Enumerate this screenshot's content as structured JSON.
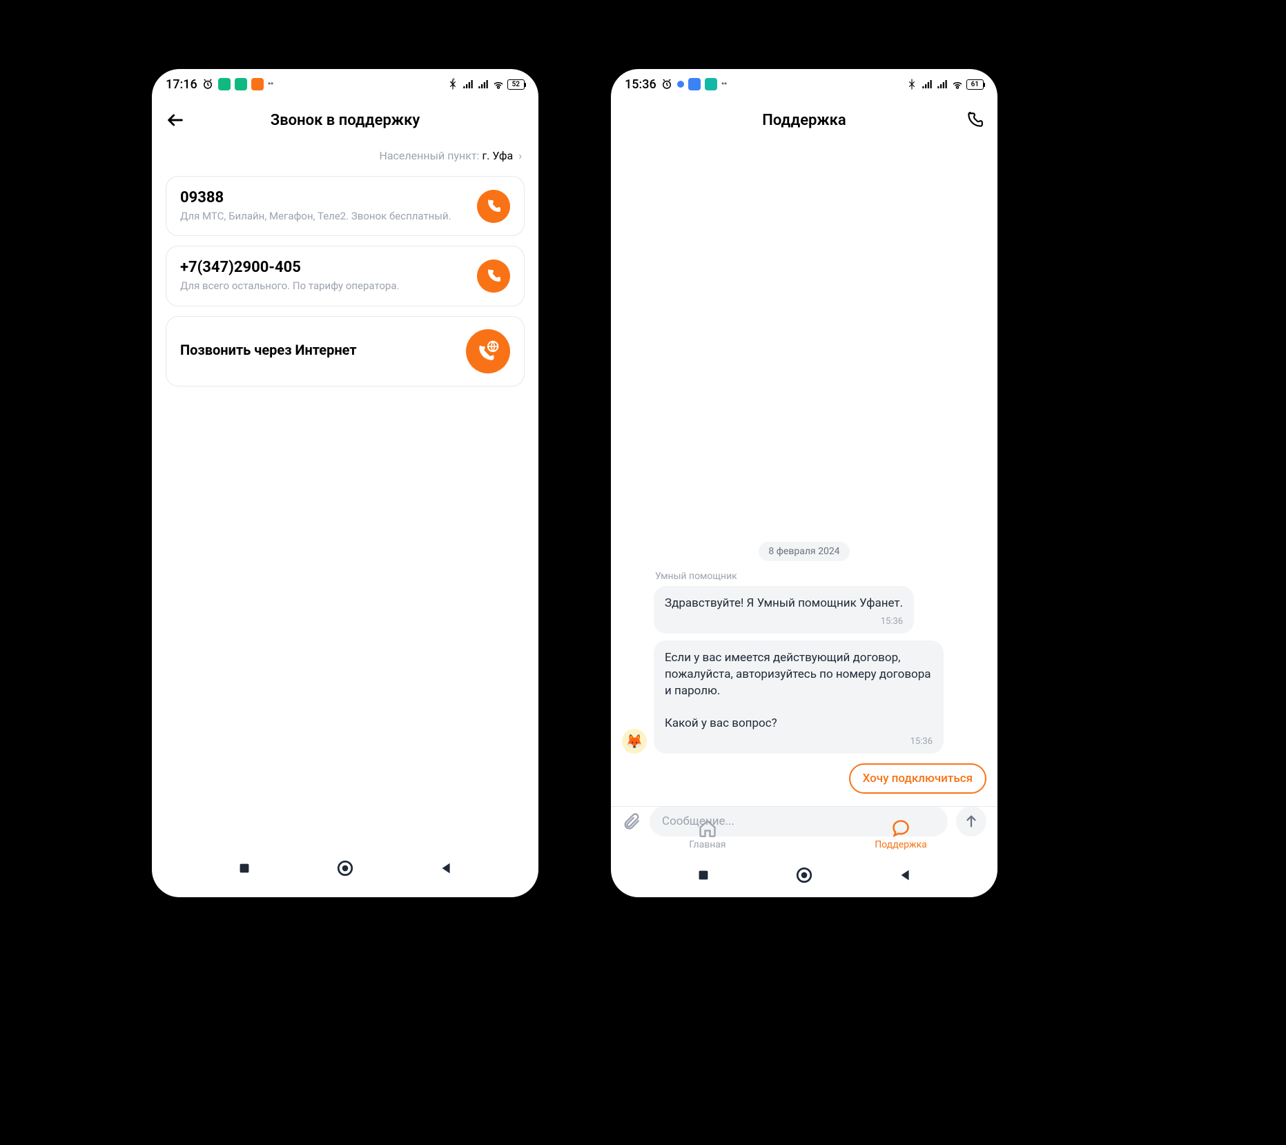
{
  "left": {
    "status": {
      "time": "17:16",
      "battery": "52"
    },
    "header": {
      "title": "Звонок в поддержку"
    },
    "location": {
      "label": "Населенный пункт:",
      "city": "г. Уфа"
    },
    "cards": [
      {
        "title": "09388",
        "sub": "Для МТС, Билайн, Мегафон, Теле2. Звонок бесплатный."
      },
      {
        "title": "+7(347)2900-405",
        "sub": "Для всего остального. По тарифу оператора."
      },
      {
        "title": "Позвонить через Интернет",
        "sub": ""
      }
    ]
  },
  "right": {
    "status": {
      "time": "15:36",
      "battery": "61"
    },
    "header": {
      "title": "Поддержка"
    },
    "chat": {
      "date": "8 февраля 2024",
      "sender": "Умный помощник",
      "messages": [
        {
          "text": "Здравствуйте! Я Умный помощник Уфанет.",
          "time": "15:36"
        },
        {
          "text": "Если у вас имеется действующий договор, пожалуйста, авторизуйтесь по номеру договора и паролю.\n\nКакой у вас вопрос?",
          "time": "15:36"
        }
      ],
      "chip": "Хочу подключиться",
      "placeholder": "Сообщение..."
    },
    "tabs": {
      "home": "Главная",
      "support": "Поддержка"
    }
  }
}
